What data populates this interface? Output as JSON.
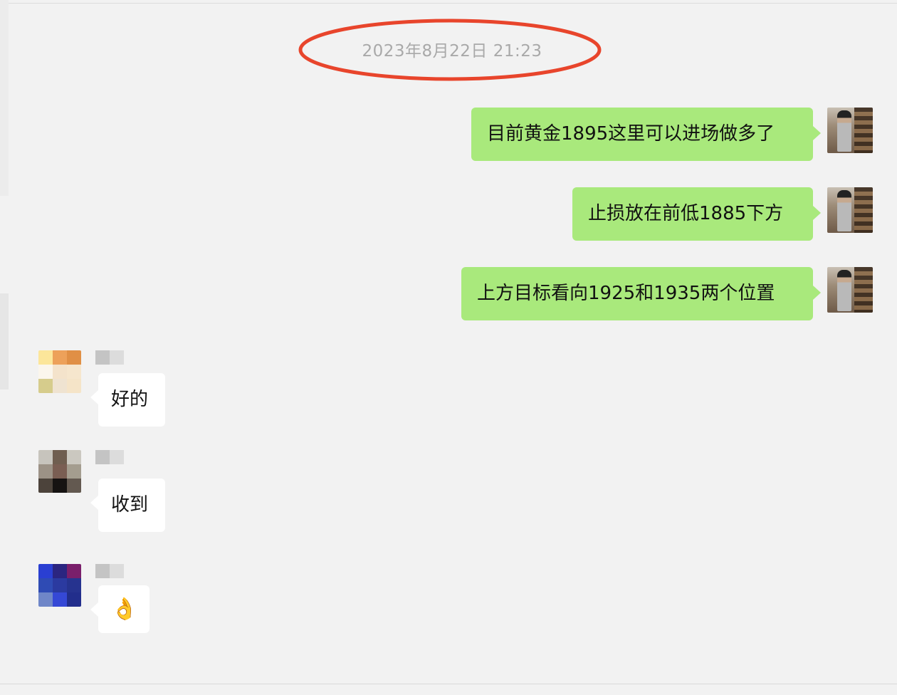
{
  "chat": {
    "timestamp": "2023年8月22日 21:23",
    "outgoing": [
      {
        "text": "目前黄金1895这里可以进场做多了"
      },
      {
        "text": "止损放在前低1885下方"
      },
      {
        "text": "上方目标看向1925和1935两个位置"
      }
    ],
    "incoming": [
      {
        "text": "好的"
      },
      {
        "text": "收到"
      },
      {
        "text": "👌"
      }
    ]
  },
  "colors": {
    "background": "#f2f2f2",
    "outgoing_bubble": "#a9e97c",
    "incoming_bubble": "#ffffff",
    "timestamp_text": "#a9a9a9",
    "highlight_ellipse": "#e8452c"
  }
}
